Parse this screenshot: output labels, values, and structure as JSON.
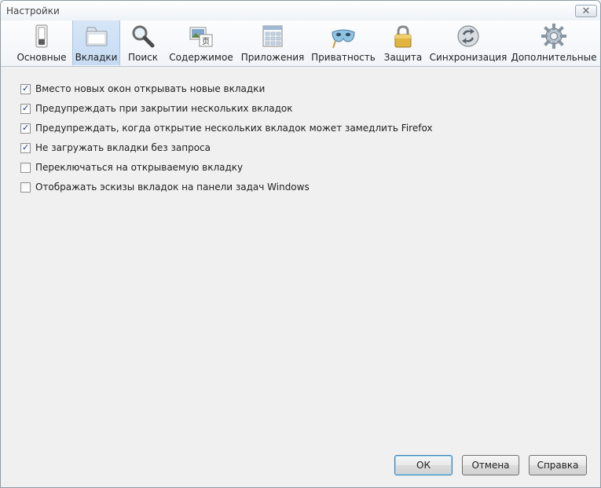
{
  "window": {
    "title": "Настройки"
  },
  "toolbar": {
    "tabs": [
      {
        "label": "Основные",
        "icon": "switch-icon"
      },
      {
        "label": "Вкладки",
        "icon": "tabs-icon",
        "selected": true
      },
      {
        "label": "Поиск",
        "icon": "magnifier-icon"
      },
      {
        "label": "Содержимое",
        "icon": "content-icon"
      },
      {
        "label": "Приложения",
        "icon": "applications-icon"
      },
      {
        "label": "Приватность",
        "icon": "mask-icon"
      },
      {
        "label": "Защита",
        "icon": "padlock-icon"
      },
      {
        "label": "Синхронизация",
        "icon": "sync-icon"
      },
      {
        "label": "Дополнительные",
        "icon": "gear-icon"
      }
    ]
  },
  "options": [
    {
      "label": "Вместо новых окон открывать новые вкладки",
      "checked": true
    },
    {
      "label": "Предупреждать при закрытии нескольких вкладок",
      "checked": true
    },
    {
      "label": "Предупреждать, когда открытие нескольких вкладок может замедлить Firefox",
      "checked": true
    },
    {
      "label": "Не загружать вкладки без запроса",
      "checked": true
    },
    {
      "label": "Переключаться на открываемую вкладку",
      "checked": false
    },
    {
      "label": "Отображать эскизы вкладок на панели задач Windows",
      "checked": false
    }
  ],
  "buttons": {
    "ok": "ОК",
    "cancel": "Отмена",
    "help": "Справка"
  },
  "colors": {
    "selected_tab": "#c6dbf3",
    "default_button_border": "#3c7fb1",
    "check_mark": "#1d3c78"
  }
}
